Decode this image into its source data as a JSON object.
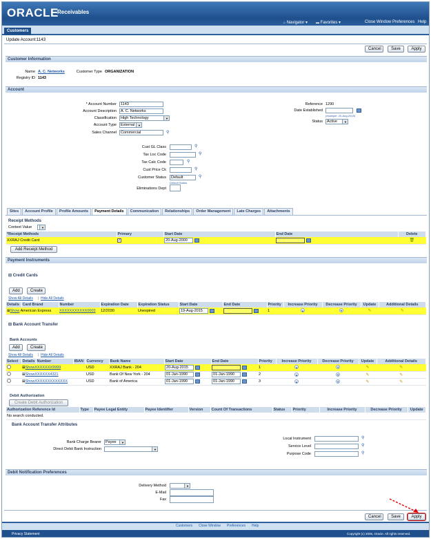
{
  "app": {
    "logo": "ORACLE",
    "product": "Receivables",
    "global_links": {
      "navigator": "Navigator",
      "favorites": "Favorites",
      "close_window": "Close Window",
      "preferences": "Preferences",
      "help": "Help"
    },
    "tab": "Customers",
    "page_title": "Update Account:1143"
  },
  "buttons": {
    "cancel": "Cancel",
    "save": "Save",
    "apply": "Apply"
  },
  "customer_information": {
    "header": "Customer Information",
    "name_label": "Name",
    "name_value": "A. C. Networks",
    "customer_type_label": "Customer Type",
    "customer_type_value": "ORGANIZATION",
    "registry_label": "Registry ID",
    "registry_value": "1143"
  },
  "account": {
    "header": "Account",
    "account_number_label": "* Account Number",
    "account_number": "1143",
    "account_description_label": "Account Description",
    "account_description": "A. C. Networks",
    "classification_label": "Classification",
    "classification": "High Technology",
    "account_type_label": "Account Type",
    "account_type": "External",
    "sales_channel_label": "Sales Channel",
    "sales_channel": "Commercial",
    "reference_label": "Reference",
    "reference": "1290",
    "date_established_label": "Date Established",
    "date_hint": "(example: 20-Aug-2015)",
    "status_label": "Status",
    "status": "Active",
    "cust_gl_class_label": "Cust GL Class",
    "tax_loc_code_label": "Tax Loc Code",
    "tax_calc_code_label": "Tax Calc Code",
    "cust_price_ck_label": "Cust Price Ck",
    "customer_status_label": "Customer Status",
    "customer_status": "Default",
    "default_status_hint": "Default Status",
    "eliminations_dept_label": "Eliminations Dept"
  },
  "subtabs": [
    "Sites",
    "Account Profile",
    "Profile Amounts",
    "Payment Details",
    "Communication",
    "Relationships",
    "Order Management",
    "Late Charges",
    "Attachments"
  ],
  "receipt_methods": {
    "header": "Receipt Methods",
    "context_value_label": "Context Value",
    "columns": [
      "*Receipt Methods",
      "Primary",
      "Start Date",
      "End Date",
      "Delete"
    ],
    "rows": [
      {
        "method": "XXRAJ Credit Card",
        "primary": "✓",
        "start_date": "20-Aug-2000",
        "end_date": ""
      }
    ],
    "add_button": "Add Receipt Method"
  },
  "payment_instruments": {
    "header": "Payment Instruments"
  },
  "credit_cards": {
    "header": "Credit Cards",
    "add": "Add",
    "create": "Create",
    "show_all": "Show All Details",
    "hide_all": "Hide All Details",
    "columns": [
      "Details",
      "Card Brand",
      "Number",
      "Expiration Date",
      "Expiration Status",
      "Start Date",
      "End Date",
      "Priority",
      "Increase Priority",
      "Decrease Priority",
      "Update",
      "Additional Details"
    ],
    "rows": [
      {
        "details": "Show",
        "brand": "American Express",
        "number": "XXXXXXXXXXX0003",
        "exp_date": "12/2030",
        "exp_status": "Unexpired",
        "start": "19-Aug-2015",
        "end": "",
        "priority": "1"
      }
    ]
  },
  "bank_account_transfer": {
    "header": "Bank Account Transfer",
    "sub_header": "Bank Accounts",
    "add": "Add",
    "create": "Create",
    "show_all": "Show All Details",
    "hide_all": "Hide All Details",
    "columns": [
      "Select",
      "Details",
      "Number",
      "IBAN",
      "Currency",
      "Bank Name",
      "Start Date",
      "End Date",
      "Priority",
      "Increase Priority",
      "Decrease Priority",
      "Update",
      "Additional Details"
    ],
    "rows": [
      {
        "details": "Show",
        "number": "XXXXXXX9999",
        "iban": "",
        "currency": "USD",
        "bank": "XXRAJ Bank - 204",
        "start": "20-Aug-2015",
        "end": "",
        "priority": "1"
      },
      {
        "details": "Show",
        "number": "XXXXXX4321",
        "iban": "",
        "currency": "USD",
        "bank": "Bank Of New York - 204",
        "start": "01-Jan-1990",
        "end": "01-Jan-1990",
        "priority": "2"
      },
      {
        "details": "Show",
        "number": "XXXXXXXXXXXXX",
        "iban": "",
        "currency": "USD",
        "bank": "Bank of America",
        "start": "01-Jan-1990",
        "end": "01-Jan-1990",
        "priority": "3"
      }
    ]
  },
  "debit_authorization": {
    "header": "Debit Authorization",
    "create_button": "Create Debit Authorization",
    "columns": [
      "Authorization Reference Id",
      "Type",
      "Payee Legal Entity",
      "Payee Identifier",
      "Version",
      "Count Of Transactions",
      "Status",
      "Priority",
      "Increase Priority",
      "Decrease Priority",
      "Update"
    ],
    "empty": "No search conducted."
  },
  "transfer_attributes": {
    "header": "Bank Account Transfer Attributes",
    "bank_charge_bearer_label": "Bank Charge Bearer",
    "bank_charge_bearer": "Payee",
    "direct_debit_label": "Direct Debit Bank Instruction",
    "local_instrument_label": "Local Instrument",
    "service_level_label": "Service Level",
    "purpose_code_label": "Purpose Code"
  },
  "debit_notification": {
    "header": "Debit Notification Preferences",
    "delivery_method_label": "Delivery Method",
    "email_label": "E-Mail",
    "fax_label": "Fax"
  },
  "footer": {
    "links": [
      "Customers",
      "Close Window",
      "Preferences",
      "Help"
    ],
    "privacy": "Privacy Statement",
    "copyright": "Copyright (c) 2006, Oracle. All rights reserved."
  }
}
